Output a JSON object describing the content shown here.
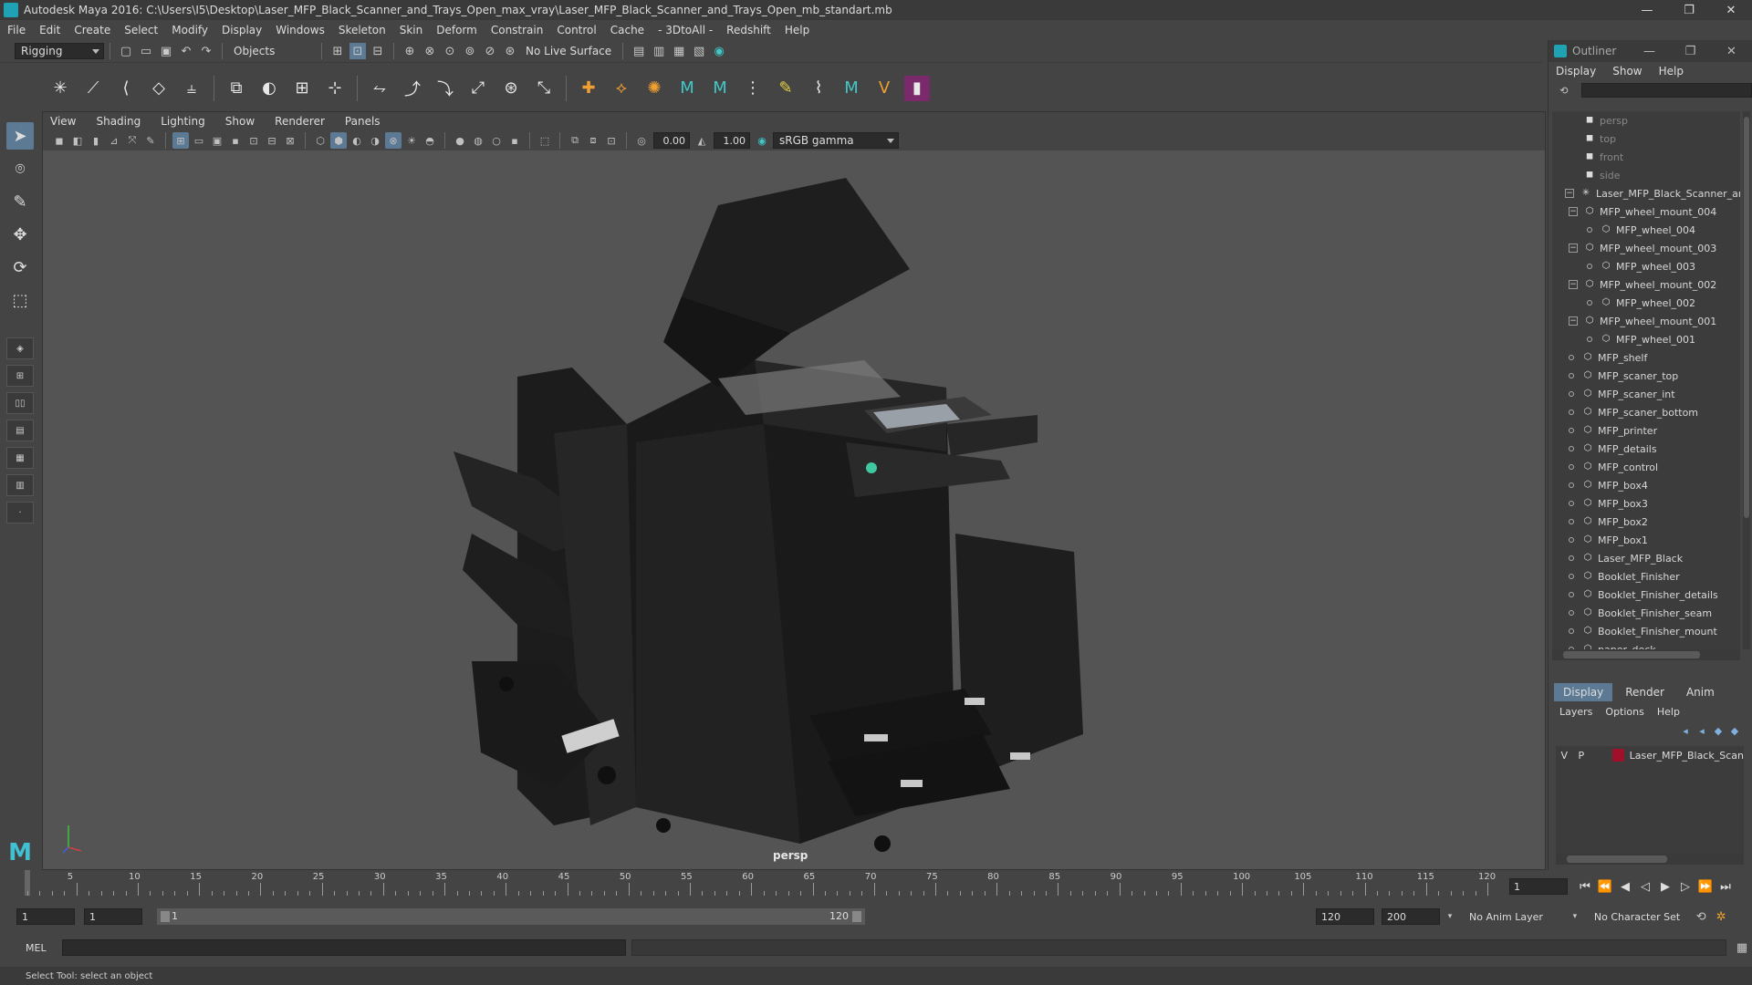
{
  "window": {
    "title": "Autodesk Maya 2016: C:\\Users\\I5\\Desktop\\Laser_MFP_Black_Scanner_and_Trays_Open_max_vray\\Laser_MFP_Black_Scanner_and_Trays_Open_mb_standart.mb",
    "minimize": "—",
    "maximize": "❐",
    "close": "✕"
  },
  "menubar": [
    "File",
    "Edit",
    "Create",
    "Select",
    "Modify",
    "Display",
    "Windows",
    "Skeleton",
    "Skin",
    "Deform",
    "Constrain",
    "Control",
    "Cache",
    "- 3DtoAll -",
    "Redshift",
    "Help"
  ],
  "statusline": {
    "mode": "Rigging",
    "selection_mode": "Objects",
    "live_surface": "No Live Surface"
  },
  "panel": {
    "menus": [
      "View",
      "Shading",
      "Lighting",
      "Show",
      "Renderer",
      "Panels"
    ],
    "exposure": "0.00",
    "gamma": "1.00",
    "color_space": "sRGB gamma",
    "camera": "persp"
  },
  "outliner": {
    "title": "Outliner",
    "menus": [
      "Display",
      "Show",
      "Help"
    ],
    "items": [
      {
        "label": "persp",
        "depth": 0,
        "kind": "camera",
        "dim": true
      },
      {
        "label": "top",
        "depth": 0,
        "kind": "camera",
        "dim": true
      },
      {
        "label": "front",
        "depth": 0,
        "kind": "camera",
        "dim": true
      },
      {
        "label": "side",
        "depth": 0,
        "kind": "camera",
        "dim": true
      },
      {
        "label": "Laser_MFP_Black_Scanner_ar",
        "depth": 0,
        "kind": "group",
        "expanded": true
      },
      {
        "label": "MFP_wheel_mount_004",
        "depth": 1,
        "kind": "mesh",
        "expanded": true
      },
      {
        "label": "MFP_wheel_004",
        "depth": 2,
        "kind": "mesh"
      },
      {
        "label": "MFP_wheel_mount_003",
        "depth": 1,
        "kind": "mesh",
        "expanded": true
      },
      {
        "label": "MFP_wheel_003",
        "depth": 2,
        "kind": "mesh"
      },
      {
        "label": "MFP_wheel_mount_002",
        "depth": 1,
        "kind": "mesh",
        "expanded": true
      },
      {
        "label": "MFP_wheel_002",
        "depth": 2,
        "kind": "mesh"
      },
      {
        "label": "MFP_wheel_mount_001",
        "depth": 1,
        "kind": "mesh",
        "expanded": true
      },
      {
        "label": "MFP_wheel_001",
        "depth": 2,
        "kind": "mesh"
      },
      {
        "label": "MFP_shelf",
        "depth": 1,
        "kind": "mesh"
      },
      {
        "label": "MFP_scaner_top",
        "depth": 1,
        "kind": "mesh"
      },
      {
        "label": "MFP_scaner_int",
        "depth": 1,
        "kind": "mesh"
      },
      {
        "label": "MFP_scaner_bottom",
        "depth": 1,
        "kind": "mesh"
      },
      {
        "label": "MFP_printer",
        "depth": 1,
        "kind": "mesh"
      },
      {
        "label": "MFP_details",
        "depth": 1,
        "kind": "mesh"
      },
      {
        "label": "MFP_control",
        "depth": 1,
        "kind": "mesh"
      },
      {
        "label": "MFP_box4",
        "depth": 1,
        "kind": "mesh"
      },
      {
        "label": "MFP_box3",
        "depth": 1,
        "kind": "mesh"
      },
      {
        "label": "MFP_box2",
        "depth": 1,
        "kind": "mesh"
      },
      {
        "label": "MFP_box1",
        "depth": 1,
        "kind": "mesh"
      },
      {
        "label": "Laser_MFP_Black",
        "depth": 1,
        "kind": "mesh"
      },
      {
        "label": "Booklet_Finisher",
        "depth": 1,
        "kind": "mesh"
      },
      {
        "label": "Booklet_Finisher_details",
        "depth": 1,
        "kind": "mesh"
      },
      {
        "label": "Booklet_Finisher_seam",
        "depth": 1,
        "kind": "mesh"
      },
      {
        "label": "Booklet_Finisher_mount",
        "depth": 1,
        "kind": "mesh"
      },
      {
        "label": "paper_deck",
        "depth": 1,
        "kind": "mesh"
      }
    ]
  },
  "layer_editor": {
    "tabs": [
      "Display",
      "Render",
      "Anim"
    ],
    "active_tab": "Display",
    "menus": [
      "Layers",
      "Options",
      "Help"
    ],
    "layers": [
      {
        "v": "V",
        "p": "P",
        "name": "Laser_MFP_Black_Scan",
        "color": "#a0102a"
      }
    ]
  },
  "timeline": {
    "ticks": [
      1,
      5,
      10,
      15,
      20,
      25,
      30,
      35,
      40,
      45,
      50,
      55,
      60,
      65,
      70,
      75,
      80,
      85,
      90,
      95,
      100,
      105,
      110,
      115,
      120
    ],
    "tick_labels": [
      "5",
      "10",
      "15",
      "20",
      "25",
      "30",
      "35",
      "40",
      "45",
      "50",
      "55",
      "60",
      "65",
      "70",
      "75",
      "80",
      "85",
      "90",
      "95",
      "100",
      "105",
      "110",
      "115",
      "120"
    ],
    "current_frame": "1"
  },
  "range": {
    "start_field": "1",
    "start_frame": "1",
    "slider_start": "1",
    "slider_end": "120",
    "end_frame": "120",
    "max_frame": "200",
    "anim_layer": "No Anim Layer",
    "character_set": "No Character Set"
  },
  "command_line": {
    "label": "MEL"
  },
  "help_line": "Select Tool: select an object",
  "colors": {
    "accent": "#5d7a95",
    "maya_teal": "#1fa2b4",
    "layer_color": "#a0102a"
  }
}
